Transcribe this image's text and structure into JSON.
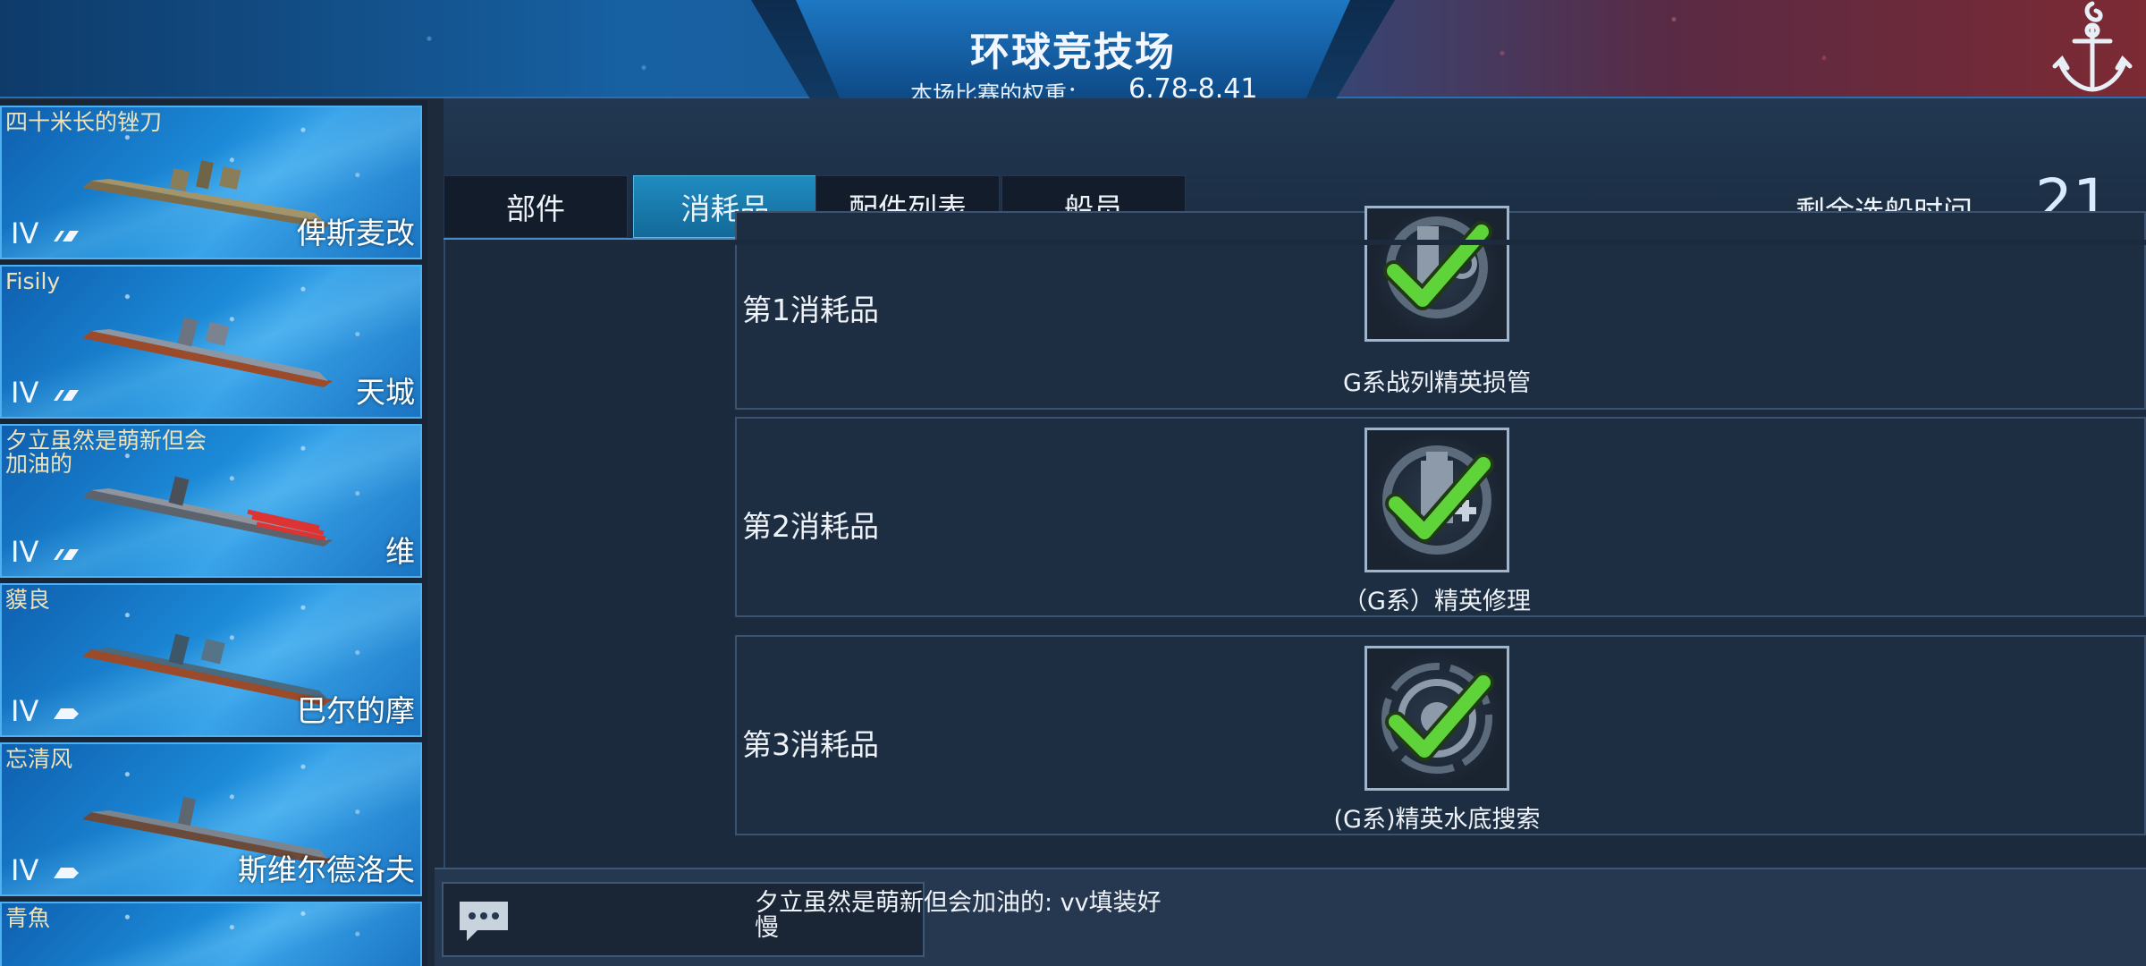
{
  "header": {
    "title": "环球竞技场",
    "weight_label": "本场比赛的权重：",
    "weight_value": "6.78-8.41",
    "anchor_icon": "anchor-icon"
  },
  "ships": [
    {
      "player": "四十米长的锉刀",
      "tier": "IV",
      "ship": "俾斯麦改",
      "class_icon": "battleship-icon"
    },
    {
      "player": "Fisily",
      "tier": "IV",
      "ship": "天城",
      "class_icon": "battleship-icon"
    },
    {
      "player": "夕立虽然是萌新但会加油的",
      "tier": "IV",
      "ship": "维",
      "class_icon": "battleship-icon"
    },
    {
      "player": "貘良",
      "tier": "IV",
      "ship": "巴尔的摩",
      "class_icon": "cruiser-icon"
    },
    {
      "player": "忘清风",
      "tier": "IV",
      "ship": "斯维尔德洛夫",
      "class_icon": "cruiser-icon"
    },
    {
      "player": "青魚",
      "tier": "",
      "ship": "",
      "class_icon": ""
    }
  ],
  "tabs": [
    {
      "label": "部件",
      "active": false
    },
    {
      "label": "消耗品",
      "active": true
    },
    {
      "label": "配件列表",
      "active": false
    },
    {
      "label": "船员",
      "active": false
    }
  ],
  "timer": {
    "label": "剩余选船时间",
    "value": "21"
  },
  "consumables": [
    {
      "slot": "第1消耗品",
      "item": "G系战列精英损管",
      "icon": "damage-control-icon",
      "selected": true
    },
    {
      "slot": "第2消耗品",
      "item": "（G系）精英修理",
      "icon": "repair-icon",
      "selected": true
    },
    {
      "slot": "第3消耗品",
      "item": "(G系)精英水底搜索",
      "icon": "hydroacoustic-search-icon",
      "selected": true
    }
  ],
  "chat": {
    "icon": "chat-bubble-icon",
    "message": "夕立虽然是萌新但会加油的: vv填装好慢"
  },
  "colors": {
    "accent": "#1f8bbf",
    "check": "#5fd43a",
    "player_name": "#f0e2b8"
  }
}
